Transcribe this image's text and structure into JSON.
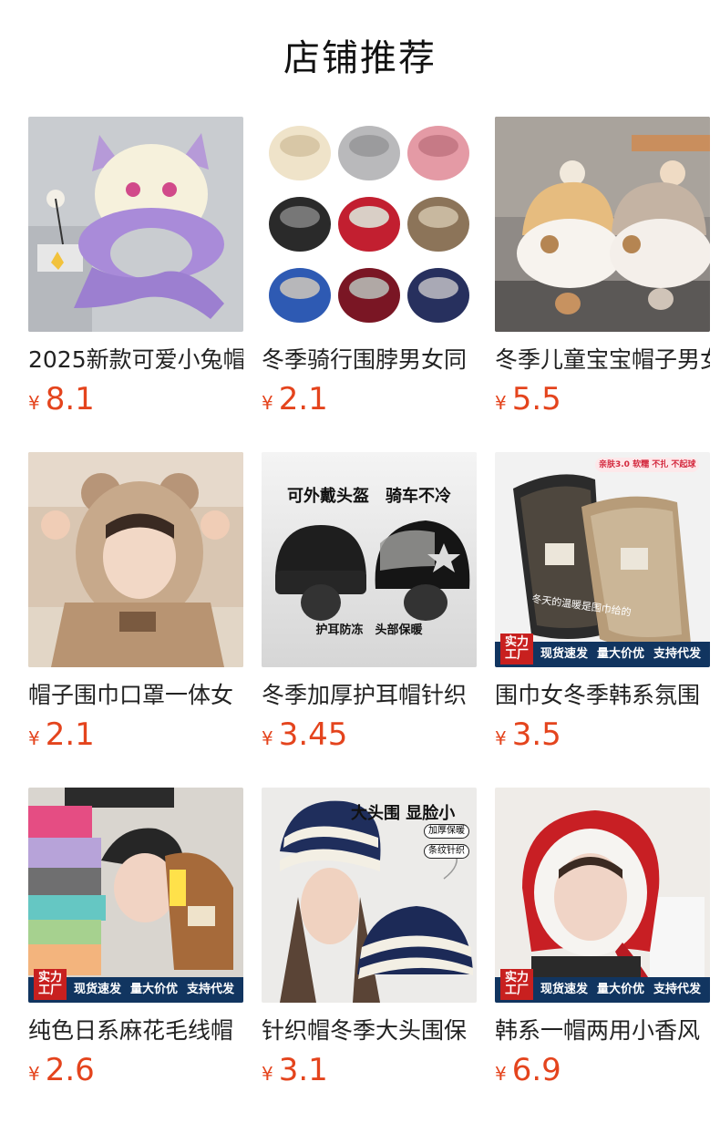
{
  "page": {
    "title": "店铺推荐"
  },
  "currency": "¥",
  "badge": {
    "tag": "实力工厂",
    "items": [
      "现货速发",
      "量大价优",
      "支持代发"
    ]
  },
  "products": [
    {
      "name": "2025新款可爱小兔帽",
      "price": "8.1"
    },
    {
      "name": "冬季骑行围脖男女同",
      "price": "2.1"
    },
    {
      "name": "冬季儿童宝宝帽子男女",
      "price": "5.5"
    },
    {
      "name": "帽子围巾口罩一体女",
      "price": "2.1"
    },
    {
      "name": "冬季加厚护耳帽针织",
      "price": "3.45"
    },
    {
      "name": "围巾女冬季韩系氛围",
      "price": "3.5"
    },
    {
      "name": "纯色日系麻花毛线帽",
      "price": "2.6"
    },
    {
      "name": "针织帽冬季大头围保",
      "price": "3.1"
    },
    {
      "name": "韩系一帽两用小香风",
      "price": "6.9"
    }
  ],
  "image_texts": {
    "p5_top": "可外戴头盔　骑车不冷",
    "p5_bottom": "护耳防冻　头部保暖",
    "p6_top": "亲肤3.0 软糯 不扎 不起球",
    "p6_script": "冬天的温暖是围巾给的",
    "p8_headline": "大头围 显脸小",
    "p8_tag1": "加厚保暖",
    "p8_tag2": "条纹针织"
  }
}
